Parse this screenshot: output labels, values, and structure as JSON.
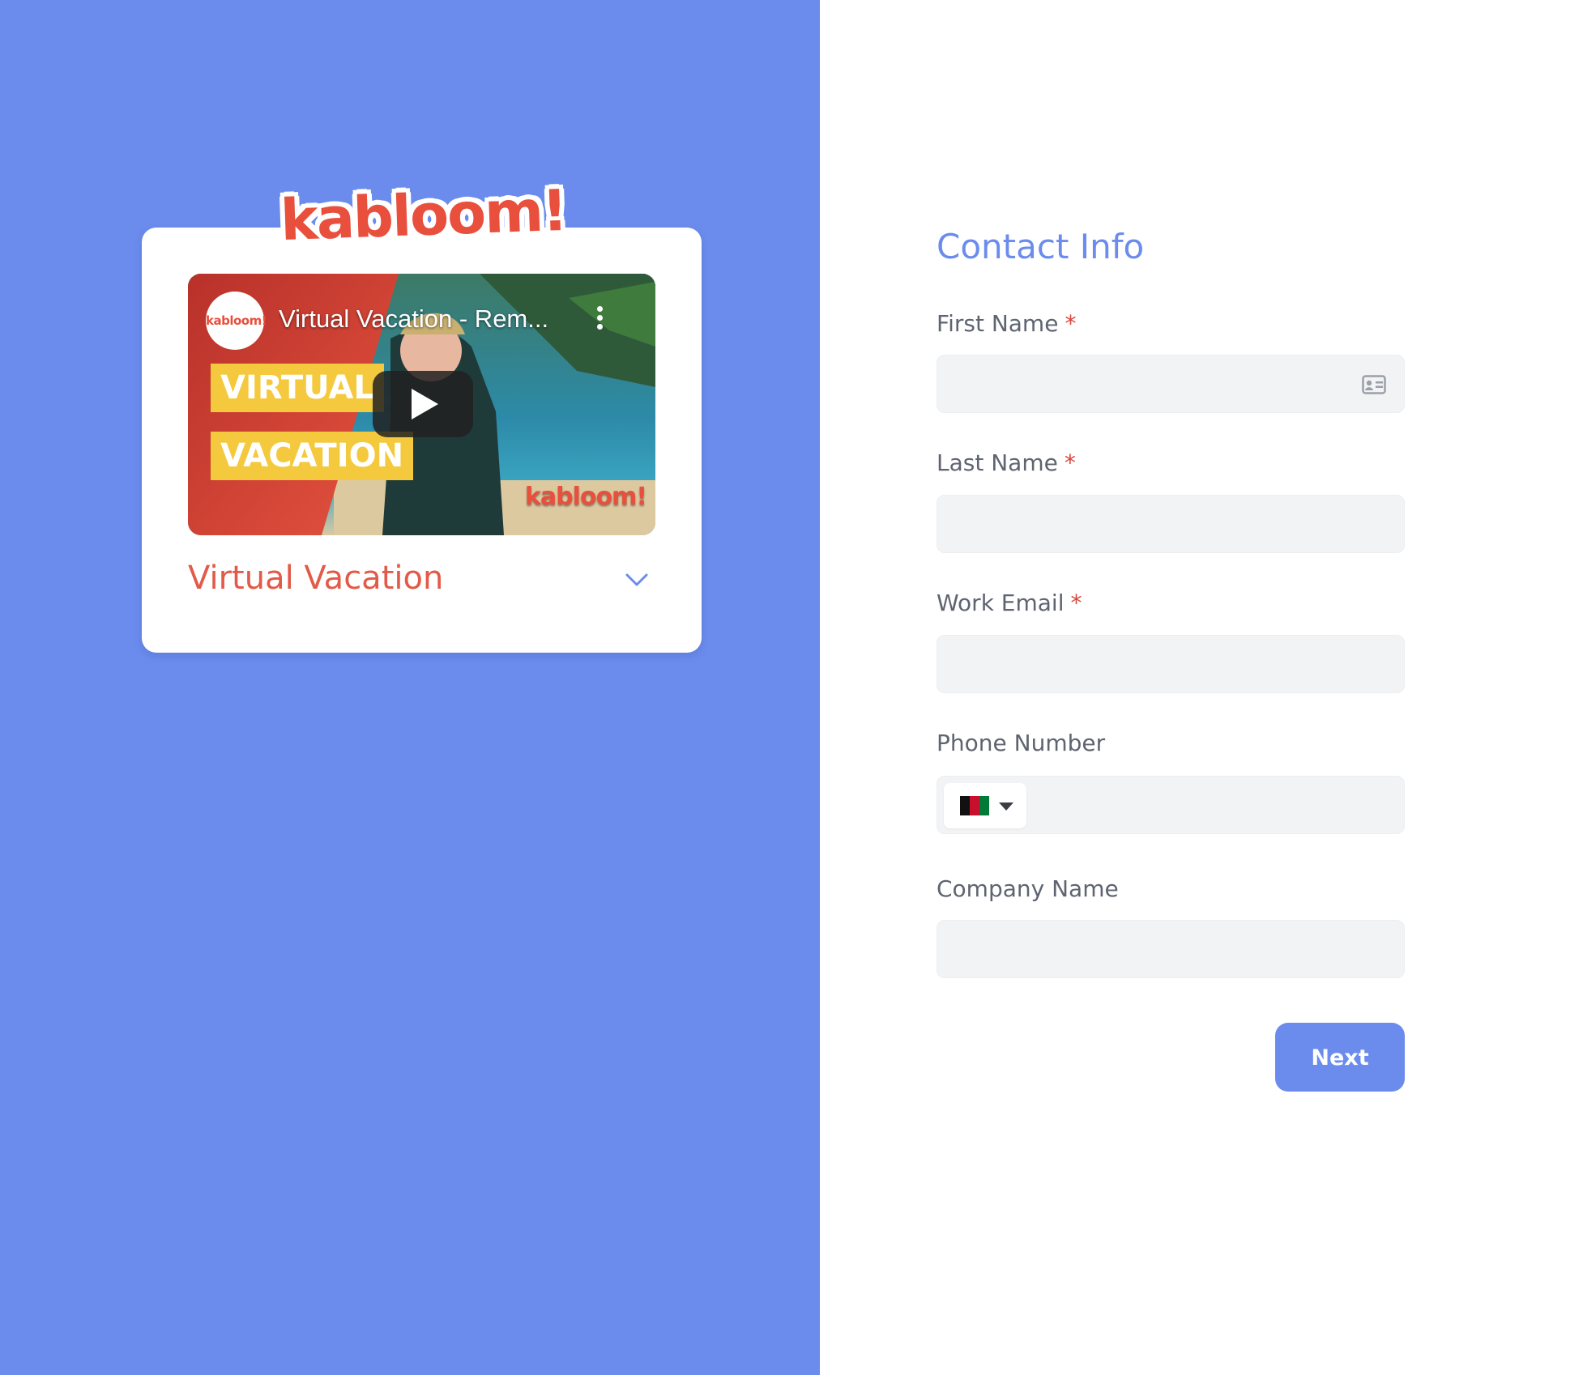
{
  "brand": {
    "logo_text": "kabloom!",
    "accent_color": "#6b8ced",
    "brand_red": "#e84f3d"
  },
  "experience_card": {
    "video": {
      "channel_avatar_text": "kabloom!",
      "title": "Virtual Vacation - Rem...",
      "overlay_line_1": "VIRTUAL",
      "overlay_line_2": "VACATION",
      "watermark": "kabloom!",
      "play_icon": "play-icon",
      "menu_icon": "more-vertical-icon"
    },
    "title": "Virtual Vacation",
    "expand_icon": "chevron-down-icon"
  },
  "form": {
    "title": "Contact Info",
    "required_mark": "*",
    "fields": {
      "first_name": {
        "label": "First Name",
        "value": "",
        "required": true,
        "icon": "contact-card-icon"
      },
      "last_name": {
        "label": "Last Name",
        "value": "",
        "required": true
      },
      "work_email": {
        "label": "Work Email",
        "value": "",
        "required": true
      },
      "phone_number": {
        "label": "Phone Number",
        "value": "",
        "required": false,
        "country_flag": "afghanistan-flag-icon"
      },
      "company_name": {
        "label": "Company Name",
        "value": "",
        "required": false
      }
    },
    "next_label": "Next"
  }
}
